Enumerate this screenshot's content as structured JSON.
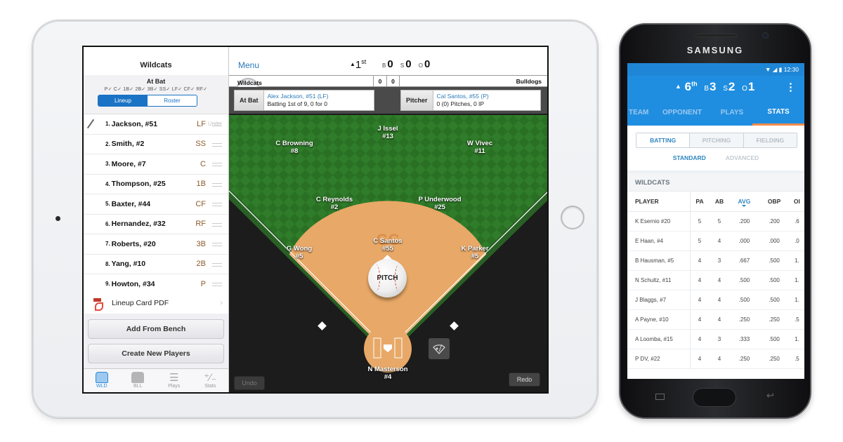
{
  "ipad": {
    "sidebar": {
      "team_name": "Wildcats",
      "at_bat_title": "At Bat",
      "positions_checked": "P✓ C✓ 1B✓ 2B✓ 3B✓ SS✓ LF✓ CF✓ RF✓",
      "segment": {
        "lineup": "Lineup",
        "roster": "Roster",
        "active": "Lineup"
      },
      "undo_label": "Undo",
      "lineup": [
        {
          "order": "1.",
          "name": "Jackson, #51",
          "pos": "LF",
          "at_bat": true
        },
        {
          "order": "2.",
          "name": "Smith, #2",
          "pos": "SS"
        },
        {
          "order": "3.",
          "name": "Moore, #7",
          "pos": "C"
        },
        {
          "order": "4.",
          "name": "Thompson, #25",
          "pos": "1B"
        },
        {
          "order": "5.",
          "name": "Baxter, #44",
          "pos": "CF"
        },
        {
          "order": "6.",
          "name": "Hernandez, #32",
          "pos": "RF"
        },
        {
          "order": "7.",
          "name": "Roberts, #20",
          "pos": "3B"
        },
        {
          "order": "8.",
          "name": "Yang, #10",
          "pos": "2B"
        },
        {
          "order": "9.",
          "name": "Howton, #34",
          "pos": "P"
        }
      ],
      "pdf_label": "Lineup Card PDF",
      "add_bench": "Add From Bench",
      "create_players": "Create New Players",
      "tabs": [
        {
          "label": "WLD",
          "icon": "jersey-icon",
          "active": true
        },
        {
          "label": "BLL",
          "icon": "jersey-icon",
          "active": false
        },
        {
          "label": "Plays",
          "icon": "list-icon",
          "active": false
        },
        {
          "label": "Stats",
          "icon": "plus-minus-icon",
          "active": false
        }
      ]
    },
    "topbar": {
      "menu": "Menu",
      "inning_arrow": "▲",
      "inning": "1",
      "inning_suffix": "st",
      "balls_label": "B",
      "balls": "0",
      "strikes_label": "S",
      "strikes": "0",
      "outs_label": "O",
      "outs": "0"
    },
    "scoreboard": {
      "home": "Wildcats",
      "home_score": "0",
      "away_score": "0",
      "away": "Bulldogs"
    },
    "at_bat": {
      "label": "At Bat",
      "name": "Alex Jackson, #51 (LF)",
      "detail": "Batting 1st of 9, 0 for 0"
    },
    "pitcher": {
      "label": "Pitcher",
      "name": "Cal Santos, #55 (P)",
      "detail": "0 (0) Pitches, 0 IP"
    },
    "fielders": [
      {
        "name": "J Issel",
        "num": "#13"
      },
      {
        "name": "C Browning",
        "num": "#8"
      },
      {
        "name": "W Vivec",
        "num": "#11"
      },
      {
        "name": "C Reynolds",
        "num": "#2"
      },
      {
        "name": "P Underwood",
        "num": "#25"
      },
      {
        "name": "C Santos",
        "num": "#55"
      },
      {
        "name": "G Wong",
        "num": "#5"
      },
      {
        "name": "K Parker",
        "num": "#5"
      },
      {
        "name": "N Masterson",
        "num": "#4"
      }
    ],
    "logo": "GC",
    "pitch_button": "PITCH",
    "undo": "Undo",
    "redo": "Redo"
  },
  "phone": {
    "brand": "SAMSUNG",
    "status_time": "12:30",
    "status_icons": "▼ ◢ ▮",
    "score": {
      "arrow": "▲",
      "inning": "6",
      "suffix": "th",
      "b_label": "B",
      "balls": "3",
      "s_label": "S",
      "strikes": "2",
      "o_label": "O",
      "outs": "1"
    },
    "menu_icon": "⋮",
    "tabs": [
      {
        "label": "TEAM",
        "active": false
      },
      {
        "label": "OPPONENT",
        "active": false
      },
      {
        "label": "PLAYS",
        "active": false
      },
      {
        "label": "STATS",
        "active": true
      }
    ],
    "stat_types": [
      "BATTING",
      "PITCHING",
      "FIELDING"
    ],
    "stat_modes": [
      "STANDARD",
      "ADVANCED"
    ],
    "team_header": "WILDCATS",
    "columns": [
      "PLAYER",
      "PA",
      "AB",
      "AVG",
      "OBP",
      "OI"
    ],
    "rows": [
      [
        "K Esernio #20",
        "5",
        "5",
        ".200",
        ".200",
        ".6"
      ],
      [
        "E Haan, #4",
        "5",
        "4",
        ".000",
        ".000",
        ".0"
      ],
      [
        "B Hausman, #5",
        "4",
        "3",
        ".667",
        ".500",
        "1."
      ],
      [
        "N Schultz, #11",
        "4",
        "4",
        ".500",
        ".500",
        "1."
      ],
      [
        "J Blaggs, #7",
        "4",
        "4",
        ".500",
        ".500",
        "1."
      ],
      [
        "A Payne, #10",
        "4",
        "4",
        ".250",
        ".250",
        ".5"
      ],
      [
        "A Loomba, #15",
        "4",
        "3",
        ".333",
        ".500",
        "1."
      ],
      [
        "P DV, #22",
        "4",
        "4",
        ".250",
        ".250",
        ".5"
      ]
    ]
  },
  "colors": {
    "accent_blue": "#1f8ee0",
    "ios_blue": "#1a73c4",
    "infield": "#e8a867",
    "grass": "#2f7d2a",
    "tab_indicator": "#f28c4b"
  }
}
